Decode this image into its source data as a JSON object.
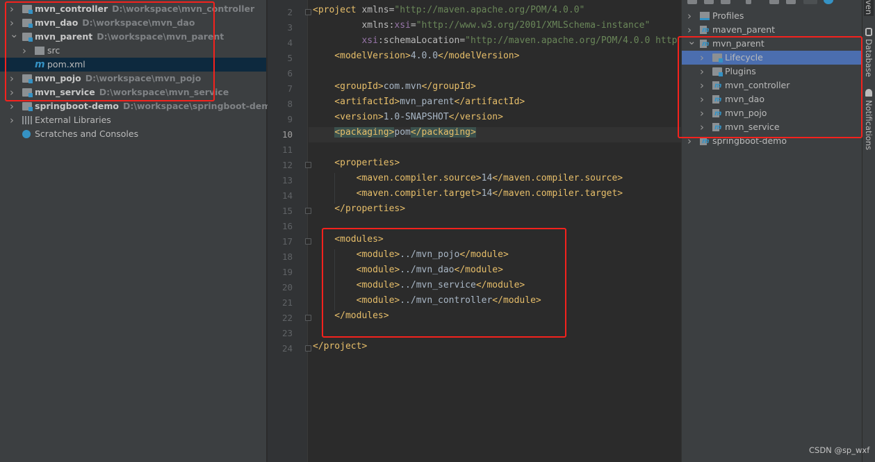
{
  "project_tree": {
    "items": [
      {
        "name": "mvn_controller",
        "path": "D:\\workspace\\mvn_controller",
        "level": 0,
        "expanded": false,
        "type": "module",
        "bold": true
      },
      {
        "name": "mvn_dao",
        "path": "D:\\workspace\\mvn_dao",
        "level": 0,
        "expanded": false,
        "type": "module",
        "bold": true
      },
      {
        "name": "mvn_parent",
        "path": "D:\\workspace\\mvn_parent",
        "level": 0,
        "expanded": true,
        "type": "module",
        "bold": true
      },
      {
        "name": "src",
        "path": "",
        "level": 1,
        "expanded": false,
        "type": "folder",
        "bold": false
      },
      {
        "name": "pom.xml",
        "path": "",
        "level": 1,
        "type": "maven-file",
        "bold": false,
        "selected": true
      },
      {
        "name": "mvn_pojo",
        "path": "D:\\workspace\\mvn_pojo",
        "level": 0,
        "expanded": false,
        "type": "module",
        "bold": true
      },
      {
        "name": "mvn_service",
        "path": "D:\\workspace\\mvn_service",
        "level": 0,
        "expanded": false,
        "type": "module",
        "bold": true
      },
      {
        "name": "springboot-demo",
        "path": "D:\\workspace\\springboot-demo",
        "level": 0,
        "expanded": false,
        "type": "module",
        "bold": true
      },
      {
        "name": "External Libraries",
        "path": "",
        "level": 0,
        "expanded": false,
        "type": "libraries",
        "bold": false
      },
      {
        "name": "Scratches and Consoles",
        "path": "",
        "level": 0,
        "type": "scratches",
        "bold": false
      }
    ]
  },
  "editor": {
    "current_line": 10,
    "lines": [
      {
        "n": 2,
        "tokens": [
          {
            "t": "<project",
            "c": "tag"
          },
          {
            "t": " xmlns=",
            "c": "attr"
          },
          {
            "t": "\"http://maven.apache.org/POM/4.0.0\"",
            "c": "str"
          }
        ]
      },
      {
        "n": 3,
        "tokens": [
          {
            "t": "         xmlns:",
            "c": "attr"
          },
          {
            "t": "xsi",
            "c": "ns"
          },
          {
            "t": "=",
            "c": "attr"
          },
          {
            "t": "\"http://www.w3.org/2001/XMLSchema-instance\"",
            "c": "str"
          }
        ]
      },
      {
        "n": 4,
        "tokens": [
          {
            "t": "         ",
            "c": "attr"
          },
          {
            "t": "xsi",
            "c": "ns"
          },
          {
            "t": ":schemaLocation=",
            "c": "attr"
          },
          {
            "t": "\"http://maven.apache.org/POM/4.0.0 http",
            "c": "str"
          }
        ]
      },
      {
        "n": 5,
        "tokens": [
          {
            "t": "    <modelVersion>",
            "c": "tag"
          },
          {
            "t": "4.0.0",
            "c": "txt"
          },
          {
            "t": "</modelVersion>",
            "c": "tag"
          }
        ]
      },
      {
        "n": 6,
        "tokens": []
      },
      {
        "n": 7,
        "tokens": [
          {
            "t": "    <groupId>",
            "c": "tag"
          },
          {
            "t": "com.mvn",
            "c": "txt"
          },
          {
            "t": "</groupId>",
            "c": "tag"
          }
        ]
      },
      {
        "n": 8,
        "tokens": [
          {
            "t": "    <artifactId>",
            "c": "tag"
          },
          {
            "t": "mvn_parent",
            "c": "txt"
          },
          {
            "t": "</artifactId>",
            "c": "tag"
          }
        ]
      },
      {
        "n": 9,
        "tokens": [
          {
            "t": "    <version>",
            "c": "tag"
          },
          {
            "t": "1.0-SNAPSHOT",
            "c": "txt"
          },
          {
            "t": "</version>",
            "c": "tag"
          }
        ]
      },
      {
        "n": 10,
        "tokens": [
          {
            "t": "    ",
            "c": "txt"
          },
          {
            "t": "<packaging>",
            "c": "tag hl"
          },
          {
            "t": "pom",
            "c": "txt"
          },
          {
            "t": "</packaging>",
            "c": "tag hl"
          }
        ]
      },
      {
        "n": 11,
        "tokens": []
      },
      {
        "n": 12,
        "tokens": [
          {
            "t": "    <properties>",
            "c": "tag"
          }
        ]
      },
      {
        "n": 13,
        "tokens": [
          {
            "t": "        <maven.compiler.source>",
            "c": "tag"
          },
          {
            "t": "14",
            "c": "txt"
          },
          {
            "t": "</maven.compiler.source>",
            "c": "tag"
          }
        ]
      },
      {
        "n": 14,
        "tokens": [
          {
            "t": "        <maven.compiler.target>",
            "c": "tag"
          },
          {
            "t": "14",
            "c": "txt"
          },
          {
            "t": "</maven.compiler.target>",
            "c": "tag"
          }
        ]
      },
      {
        "n": 15,
        "tokens": [
          {
            "t": "    </properties>",
            "c": "tag"
          }
        ]
      },
      {
        "n": 16,
        "tokens": []
      },
      {
        "n": 17,
        "tokens": [
          {
            "t": "    <modules>",
            "c": "tag"
          }
        ]
      },
      {
        "n": 18,
        "tokens": [
          {
            "t": "        <module>",
            "c": "tag"
          },
          {
            "t": "../mvn_pojo",
            "c": "txt"
          },
          {
            "t": "</module>",
            "c": "tag"
          }
        ]
      },
      {
        "n": 19,
        "tokens": [
          {
            "t": "        <module>",
            "c": "tag"
          },
          {
            "t": "../mvn_dao",
            "c": "txt"
          },
          {
            "t": "</module>",
            "c": "tag"
          }
        ]
      },
      {
        "n": 20,
        "tokens": [
          {
            "t": "        <module>",
            "c": "tag"
          },
          {
            "t": "../mvn_service",
            "c": "txt"
          },
          {
            "t": "</module>",
            "c": "tag"
          }
        ]
      },
      {
        "n": 21,
        "tokens": [
          {
            "t": "        <module>",
            "c": "tag"
          },
          {
            "t": "../mvn_controller",
            "c": "txt"
          },
          {
            "t": "</module>",
            "c": "tag"
          }
        ]
      },
      {
        "n": 22,
        "tokens": [
          {
            "t": "    </modules>",
            "c": "tag"
          }
        ]
      },
      {
        "n": 23,
        "tokens": []
      },
      {
        "n": 24,
        "tokens": [
          {
            "t": "</project>",
            "c": "tag"
          }
        ]
      }
    ]
  },
  "maven_panel": {
    "items": [
      {
        "name": "Profiles",
        "level": 0,
        "expanded": false,
        "type": "profiles"
      },
      {
        "name": "maven_parent",
        "level": 0,
        "expanded": false,
        "type": "maven"
      },
      {
        "name": "mvn_parent",
        "level": 0,
        "expanded": true,
        "type": "maven"
      },
      {
        "name": "Lifecycle",
        "level": 1,
        "expanded": false,
        "type": "config-folder",
        "selected": true
      },
      {
        "name": "Plugins",
        "level": 1,
        "expanded": false,
        "type": "config-folder"
      },
      {
        "name": "mvn_controller",
        "level": 1,
        "expanded": false,
        "type": "maven"
      },
      {
        "name": "mvn_dao",
        "level": 1,
        "expanded": false,
        "type": "maven"
      },
      {
        "name": "mvn_pojo",
        "level": 1,
        "expanded": false,
        "type": "maven"
      },
      {
        "name": "mvn_service",
        "level": 1,
        "expanded": false,
        "type": "maven"
      },
      {
        "name": "springboot-demo",
        "level": 0,
        "expanded": false,
        "type": "maven"
      }
    ]
  },
  "side_stripe": {
    "maven_tab": "ven",
    "database_tab": "Database",
    "notifications_tab": "Notifications"
  },
  "watermark": "CSDN @sp_wxf",
  "colors": {
    "highlight_box": "#f4221d",
    "selection": "#4b6eaf",
    "tag": "#e8bf6a",
    "string": "#6a8759"
  }
}
